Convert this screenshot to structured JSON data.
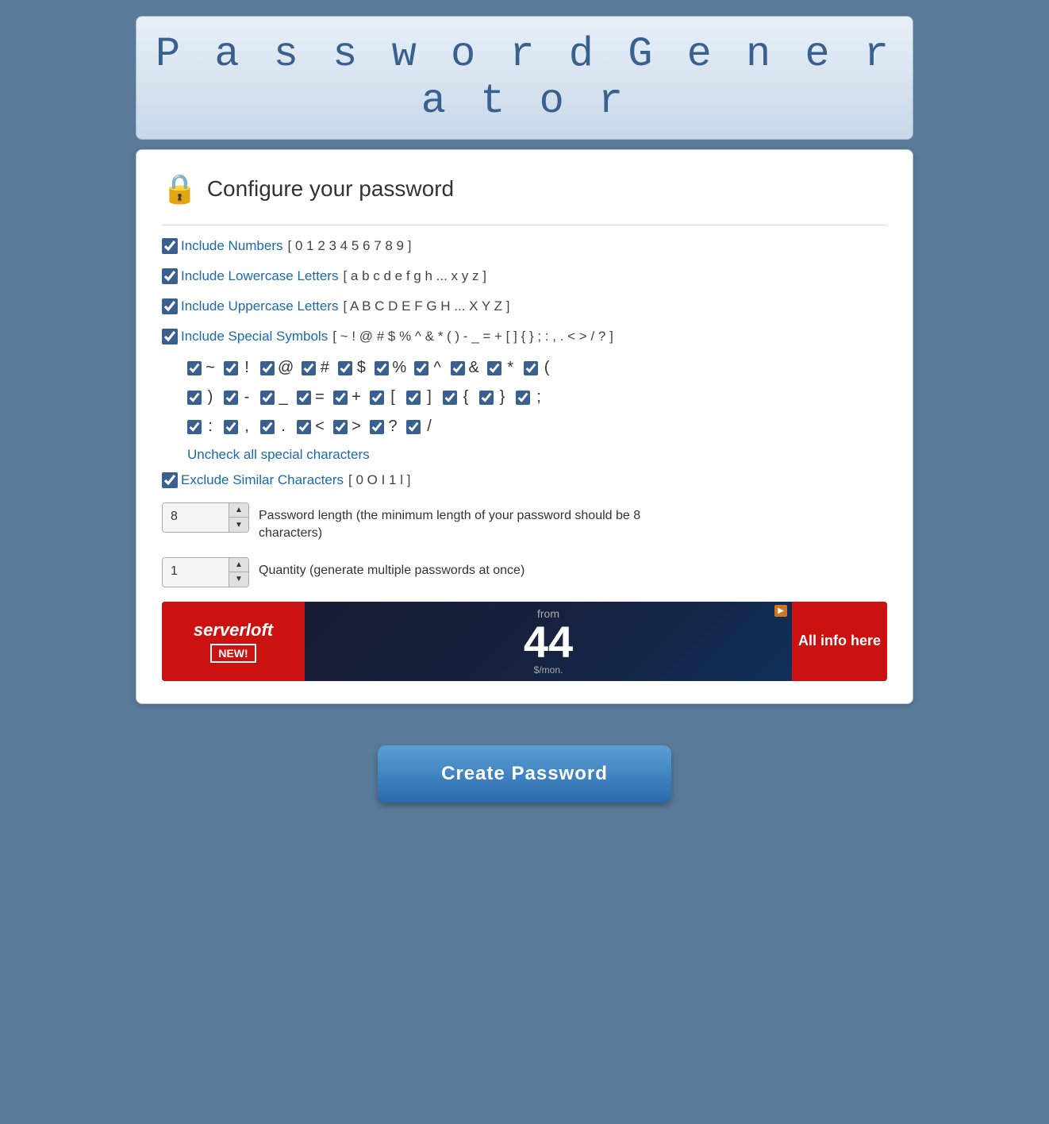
{
  "header": {
    "title": "P a s s w o r d   G e n e r a t o r"
  },
  "configure": {
    "heading": "Configure your password",
    "lock_icon": "🔒"
  },
  "options": {
    "include_numbers": {
      "label": "Include Numbers",
      "suffix": "[ 0 1 2 3 4 5 6 7 8 9 ]",
      "checked": true
    },
    "include_lowercase": {
      "label": "Include Lowercase Letters",
      "suffix": "[ a b c d e f g h ... x y z ]",
      "checked": true
    },
    "include_uppercase": {
      "label": "Include Uppercase Letters",
      "suffix": "[ A B C D E F G H ... X Y Z ]",
      "checked": true
    },
    "include_special": {
      "label": "Include Special Symbols",
      "suffix": "[ ~ ! @ # $ % ^ & * ( ) - _ = + [ ] { } ; : , . < > / ? ]",
      "checked": true
    },
    "exclude_similar": {
      "label": "Exclude Similar Characters",
      "suffix": "[ 0 O I 1 l ]",
      "checked": true
    }
  },
  "special_chars": {
    "row1": [
      "~",
      "!",
      "@",
      "#",
      "$",
      "%",
      "^",
      "&",
      "*",
      "("
    ],
    "row2": [
      ")",
      "-",
      "_",
      "=",
      "+",
      "[",
      "]",
      "{",
      "}",
      ";"
    ],
    "row3": [
      ":",
      ",",
      ".",
      "<",
      ">",
      "?",
      "/"
    ]
  },
  "uncheck_label": "Uncheck all special characters",
  "password_length": {
    "value": "8",
    "label": "Password length (the minimum length of your password should be 8 characters)"
  },
  "quantity": {
    "value": "1",
    "label": "Quantity (generate multiple passwords at once)"
  },
  "ad": {
    "brand": "serverloft",
    "new_label": "NEW!",
    "from_text": "from",
    "price": "44",
    "per_month": "$/mon.",
    "info": "All info here"
  },
  "create_button": "Create Password"
}
